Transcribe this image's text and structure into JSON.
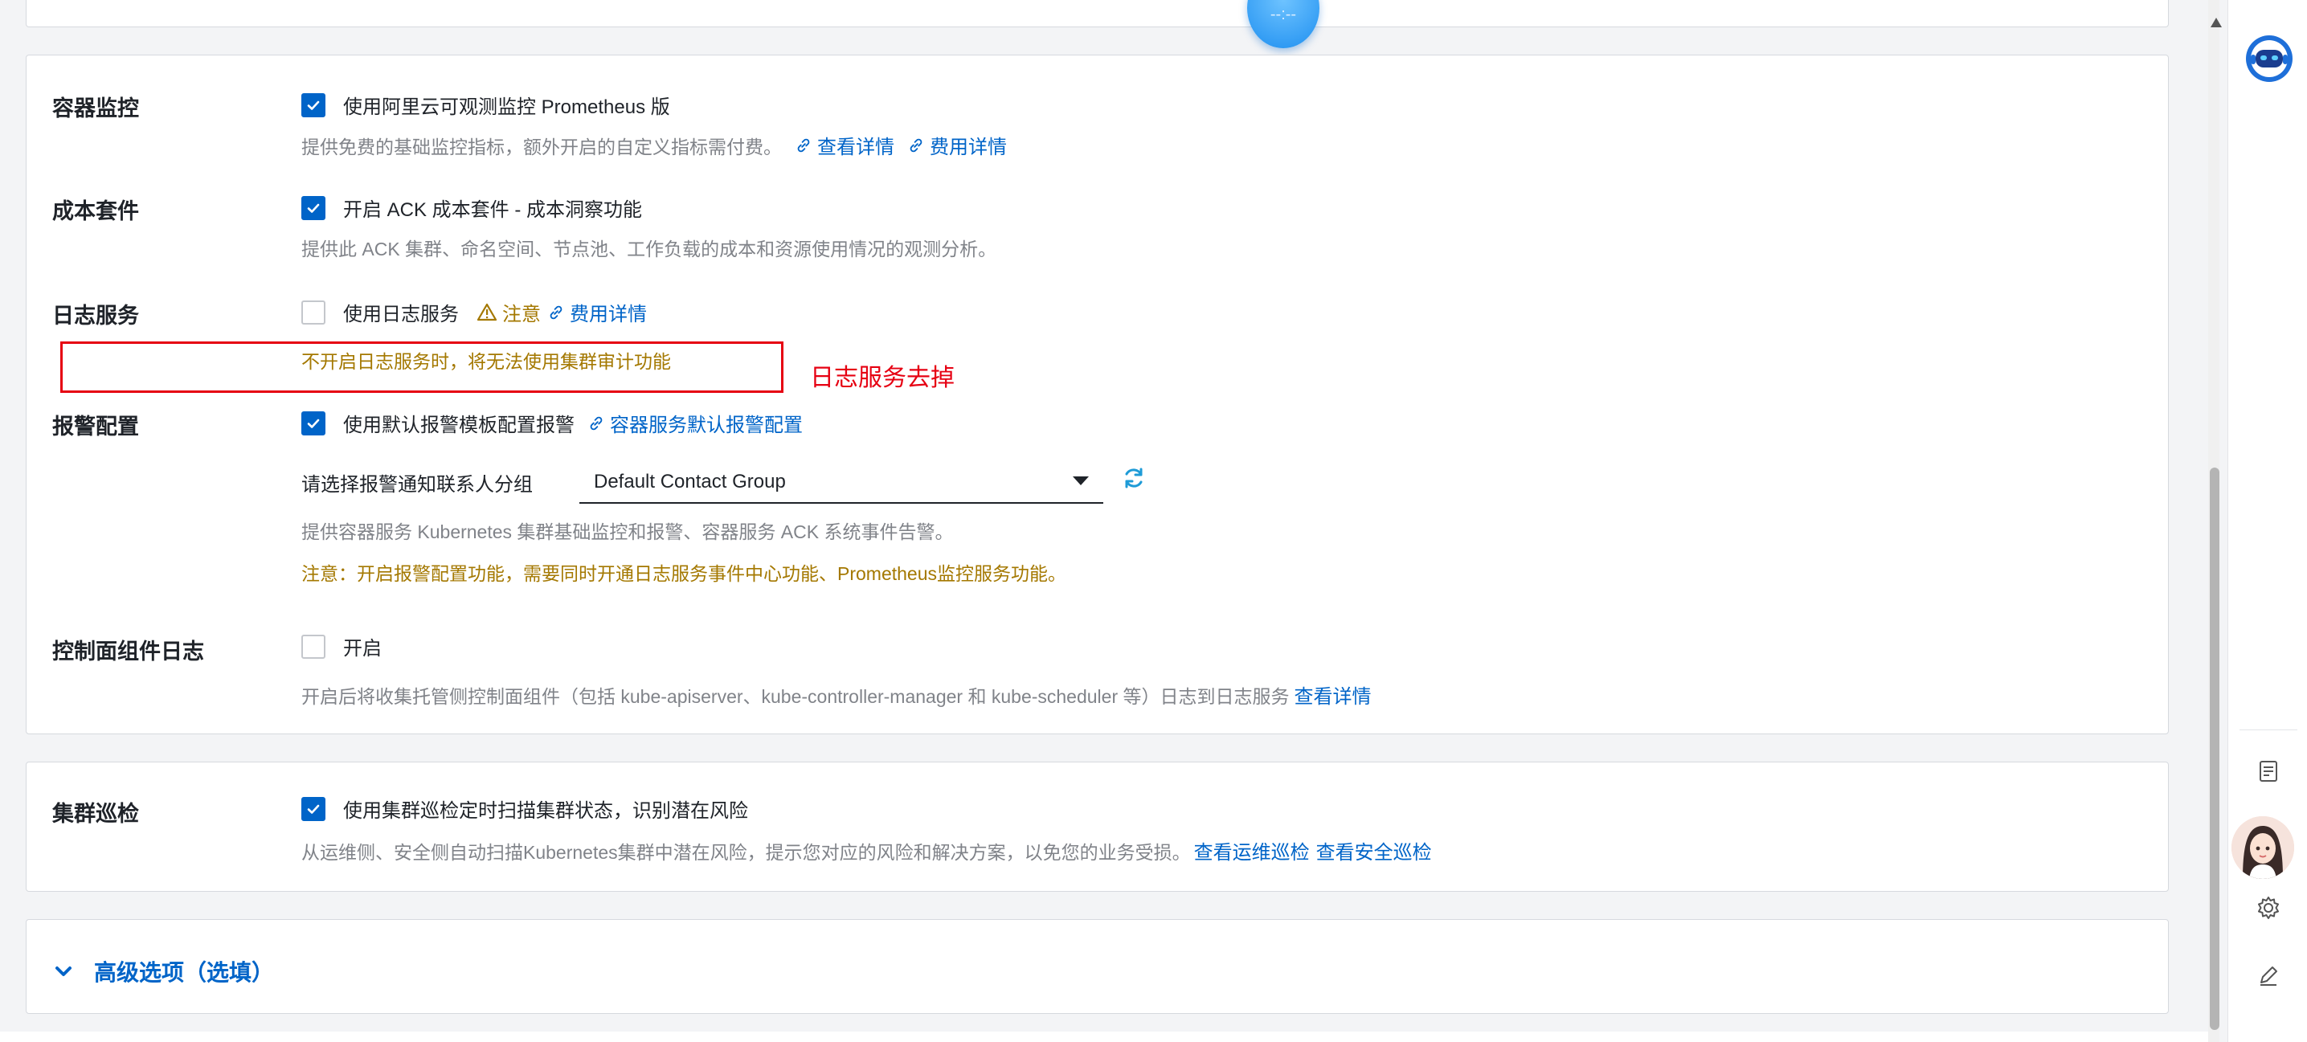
{
  "top_badge": {
    "label": "--:--"
  },
  "container_monitoring": {
    "label": "容器监控",
    "checkbox_text": "使用阿里云可观测监控 Prometheus 版",
    "checked": true,
    "desc": "提供免费的基础监控指标，额外开启的自定义指标需付费。",
    "link_details": "查看详情",
    "link_cost": "费用详情"
  },
  "cost_suite": {
    "label": "成本套件",
    "checkbox_text": "开启 ACK 成本套件 - 成本洞察功能",
    "checked": true,
    "desc": "提供此 ACK 集群、命名空间、节点池、工作负载的成本和资源使用情况的观测分析。"
  },
  "log_service": {
    "label": "日志服务",
    "checkbox_text": "使用日志服务",
    "checked": false,
    "notice_label": "注意",
    "link_cost": "费用详情",
    "warning": "不开启日志服务时，将无法使用集群审计功能"
  },
  "annotation": {
    "text": "日志服务去掉",
    "color": "#e60012"
  },
  "alert_config": {
    "label": "报警配置",
    "checkbox_text": "使用默认报警模板配置报警",
    "checked": true,
    "link": "容器服务默认报警配置",
    "select_label": "请选择报警通知联系人分组",
    "select_value": "Default Contact Group",
    "desc": "提供容器服务 Kubernetes 集群基础监控和报警、容器服务 ACK 系统事件告警。",
    "note": "注意：开启报警配置功能，需要同时开通日志服务事件中心功能、Prometheus监控服务功能。"
  },
  "control_plane_logs": {
    "label": "控制面组件日志",
    "checkbox_text": "开启",
    "checked": false,
    "desc": "开启后将收集托管侧控制面组件（包括 kube-apiserver、kube-controller-manager 和 kube-scheduler 等）日志到日志服务",
    "link": "查看详情"
  },
  "cluster_inspection": {
    "label": "集群巡检",
    "checkbox_text": "使用集群巡检定时扫描集群状态，识别潜在风险",
    "checked": true,
    "desc": "从运维侧、安全侧自动扫描Kubernetes集群中潜在风险，提示您对应的风险和解决方案，以免您的业务受损。",
    "link_ops": "查看运维巡检",
    "link_security": "查看安全巡检"
  },
  "advanced": {
    "label": "高级选项（选填）"
  },
  "colors": {
    "primary": "#0064c8",
    "warning": "#a47800",
    "annotation": "#e60012"
  },
  "right_rail": {
    "icons": [
      "robot-assistant-icon",
      "document-icon",
      "avatar",
      "settings-icon",
      "edit-icon"
    ]
  }
}
